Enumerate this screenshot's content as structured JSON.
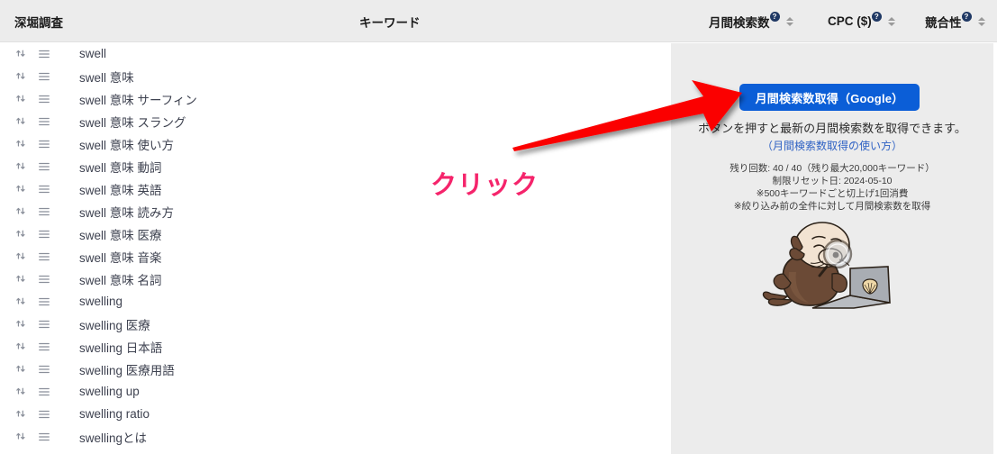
{
  "header": {
    "columns": [
      {
        "id": "fukabori",
        "label": "深堀調査",
        "has_help": false,
        "sortable": false
      },
      {
        "id": "keyword",
        "label": "キーワード",
        "has_help": false,
        "sortable": false
      },
      {
        "id": "volume",
        "label": "月間検索数",
        "has_help": true,
        "help_glyph": "?",
        "sortable": true
      },
      {
        "id": "cpc",
        "label": "CPC ($)",
        "has_help": true,
        "help_glyph": "?",
        "sortable": true
      },
      {
        "id": "competition",
        "label": "競合性",
        "has_help": true,
        "help_glyph": "?",
        "sortable": true
      }
    ]
  },
  "rows": [
    {
      "keyword": "swell"
    },
    {
      "keyword": "swell 意味"
    },
    {
      "keyword": "swell 意味 サーフィン"
    },
    {
      "keyword": "swell 意味 スラング"
    },
    {
      "keyword": "swell 意味 使い方"
    },
    {
      "keyword": "swell 意味 動詞"
    },
    {
      "keyword": "swell 意味 英語"
    },
    {
      "keyword": "swell 意味 読み方"
    },
    {
      "keyword": "swell 意味 医療"
    },
    {
      "keyword": "swell 意味 音楽"
    },
    {
      "keyword": "swell 意味 名詞"
    },
    {
      "keyword": "swelling"
    },
    {
      "keyword": "swelling 医療"
    },
    {
      "keyword": "swelling 日本語"
    },
    {
      "keyword": "swelling 医療用語"
    },
    {
      "keyword": "swelling up"
    },
    {
      "keyword": "swelling ratio"
    },
    {
      "keyword": "swellingとは"
    }
  ],
  "side_panel": {
    "fetch_button_label": "月間検索数取得（Google）",
    "description": "ボタンを押すと最新の月間検索数を取得できます。",
    "help_link_label": "（月間検索数取得の使い方）",
    "fineprint": [
      "残り回数: 40 / 40（残り最大20,000キーワード）",
      "制限リセット日: 2024-05-10",
      "※500キーワードごと切上げ1回消費",
      "※絞り込み前の全件に対して月間検索数を取得"
    ],
    "mascot_alt": "mole-with-magnifier-laptop-mascot"
  },
  "annotations": {
    "click_label": "クリック",
    "arrow_color": "#fb0000",
    "click_text_color": "#f5246b"
  },
  "colors": {
    "header_bg": "#ececec",
    "panel_bg": "#ececec",
    "button_bg": "#0b5ed7",
    "link": "#2f62c4",
    "row_text": "#3e4250",
    "icon": "#8a8f9a"
  },
  "icons": {
    "swap": "swap-arrows-icon",
    "list": "hamburger-list-icon"
  }
}
